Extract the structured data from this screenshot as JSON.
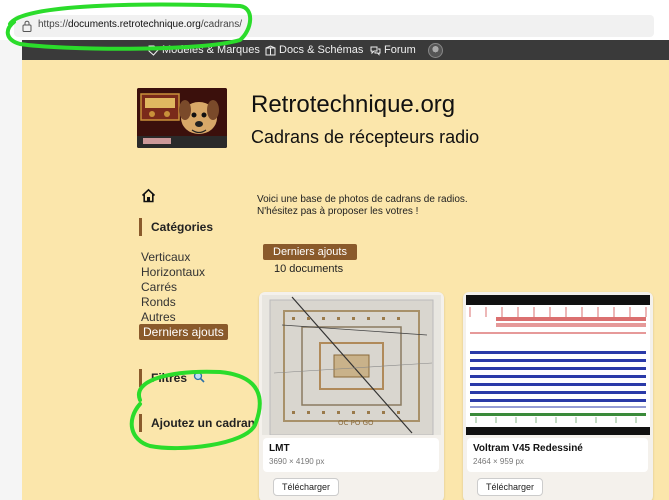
{
  "browser": {
    "url_prefix": "https://",
    "url_domain": "documents.retrotechnique.org",
    "url_path": "/cadrans/"
  },
  "nav": {
    "items": [
      {
        "label": "Modèles & Marques",
        "icon": "tag-icon"
      },
      {
        "label": "Docs & Schémas",
        "icon": "docs-icon"
      },
      {
        "label": "Forum",
        "icon": "forum-icon"
      }
    ]
  },
  "site": {
    "title": "Retrotechnique.org",
    "subtitle": "Cadrans de récepteurs radio"
  },
  "sidebar": {
    "categories_heading": "Catégories",
    "categories": [
      "Verticaux",
      "Horizontaux",
      "Carrés",
      "Ronds",
      "Autres"
    ],
    "active_category": "Derniers ajouts",
    "filters_heading": "Filtres",
    "add_heading": "Ajoutez un cadran"
  },
  "main": {
    "intro_line1": "Voici une base de photos de cadrans de radios.",
    "intro_line2": "N'hésitez pas à proposer les votres !",
    "tag": "Derniers ajouts",
    "count": "10 documents"
  },
  "cards": [
    {
      "name": "LMT",
      "dims": "3690 × 4190 px",
      "button": "Télécharger"
    },
    {
      "name": "Voltram V45 Redessiné",
      "dims": "2464 × 959 px",
      "button": "Télécharger"
    }
  ],
  "colors": {
    "page_bg": "#fbe6ab",
    "accent": "#8a5a2b",
    "nav_bg": "#3a3a3a",
    "annotation": "#2bdc2b"
  }
}
